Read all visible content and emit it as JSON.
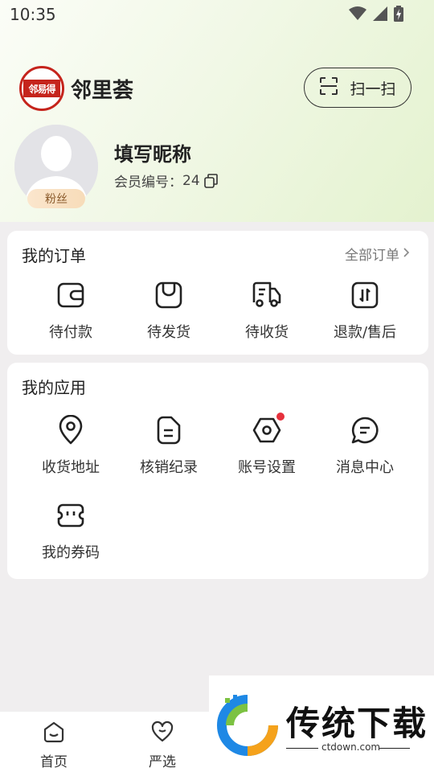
{
  "status_bar": {
    "time": "10:35"
  },
  "header": {
    "brand_logo_text": "邻易得",
    "brand_name": "邻里荟",
    "scan_label": "扫一扫"
  },
  "profile": {
    "nickname": "填写昵称",
    "member_label": "会员编号：",
    "member_id": "24",
    "badge": "粉丝"
  },
  "orders": {
    "title": "我的订单",
    "all_label": "全部订单",
    "items": [
      {
        "label": "待付款",
        "icon": "wallet-icon"
      },
      {
        "label": "待发货",
        "icon": "package-icon"
      },
      {
        "label": "待收货",
        "icon": "truck-icon"
      },
      {
        "label": "退款/售后",
        "icon": "refund-icon"
      }
    ]
  },
  "apps": {
    "title": "我的应用",
    "items": [
      {
        "label": "收货地址",
        "icon": "location-icon"
      },
      {
        "label": "核销纪录",
        "icon": "record-icon"
      },
      {
        "label": "账号设置",
        "icon": "settings-icon",
        "dot": true
      },
      {
        "label": "消息中心",
        "icon": "message-icon"
      },
      {
        "label": "我的券码",
        "icon": "coupon-icon"
      }
    ]
  },
  "tabbar": {
    "items": [
      {
        "label": "首页",
        "icon": "home-icon"
      },
      {
        "label": "严选",
        "icon": "heart-icon"
      }
    ]
  },
  "watermark": {
    "title": "传统下载",
    "url": "ctdown.com"
  },
  "colors": {
    "accent_red": "#e6303c",
    "brand_red": "#c5241c",
    "badge_text": "#8a5a2b"
  }
}
